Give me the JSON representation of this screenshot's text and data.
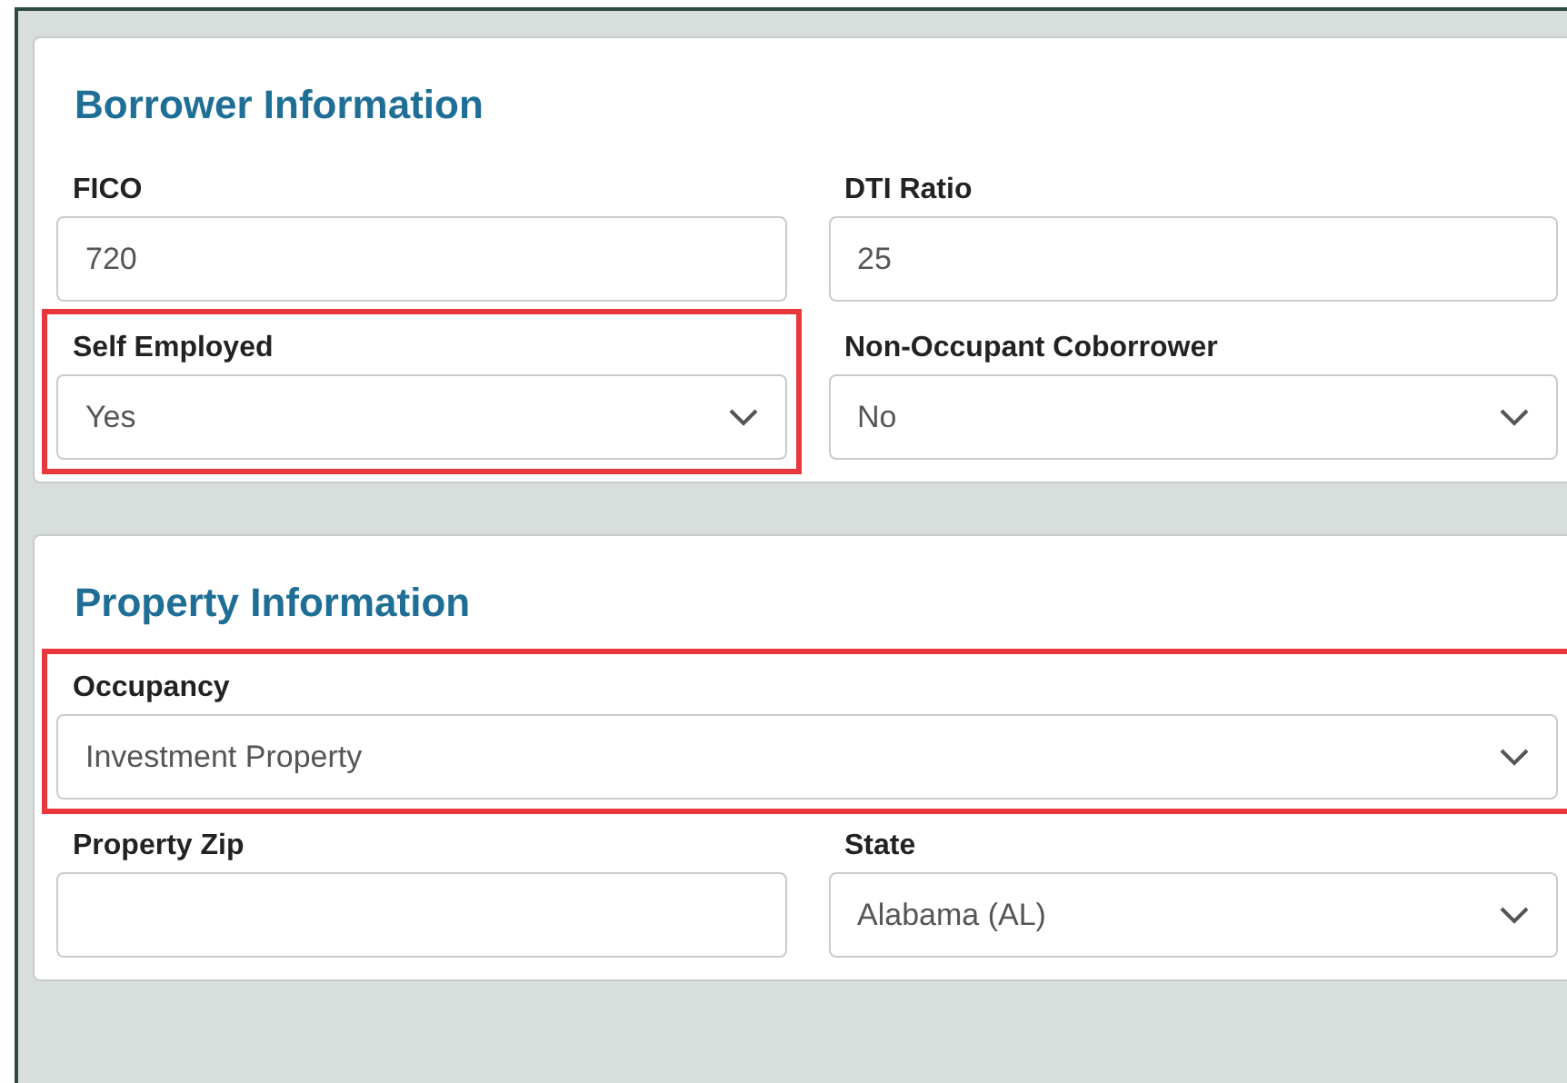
{
  "sections": [
    {
      "title": "Borrower Information",
      "rows": [
        [
          {
            "label": "FICO",
            "kind": "text",
            "value": "720",
            "highlighted": false
          },
          {
            "label": "DTI Ratio",
            "kind": "text",
            "value": "25",
            "highlighted": false
          }
        ],
        [
          {
            "label": "Self Employed",
            "kind": "select",
            "value": "Yes",
            "highlighted": true
          },
          {
            "label": "Non-Occupant Coborrower",
            "kind": "select",
            "value": "No",
            "highlighted": false
          }
        ]
      ]
    },
    {
      "title": "Property Information",
      "rows": [
        [
          {
            "label": "Occupancy",
            "kind": "select",
            "value": "Investment Property",
            "highlighted": true
          }
        ],
        [
          {
            "label": "Property Zip",
            "kind": "text",
            "highlighted": false
          },
          {
            "label": "State",
            "kind": "select",
            "value": "Alabama (AL)",
            "highlighted": false
          }
        ]
      ]
    }
  ]
}
